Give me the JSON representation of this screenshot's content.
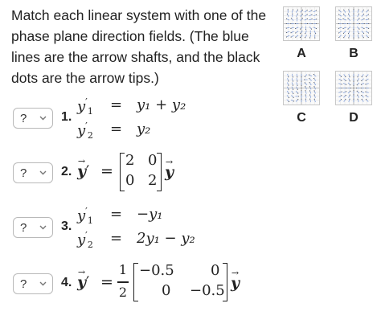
{
  "prompt": "Match each linear system with one of the phase plane direction fields. (The blue lines are the arrow shafts, and the black dots are the arrow tips.)",
  "options": [
    "A",
    "B",
    "C",
    "D"
  ],
  "dropdown_value": "?",
  "questions": [
    {
      "number": "1.",
      "row1": {
        "lhs": "y",
        "sub": "1",
        "prime": "′",
        "eq": "=",
        "rhs": "y₁ + y₂"
      },
      "row2": {
        "lhs": "y",
        "sub": "2",
        "prime": "′",
        "eq": "=",
        "rhs": "y₂"
      }
    },
    {
      "number": "2.",
      "vec": "y",
      "prime": "′",
      "eq": "=",
      "matrix": [
        "2",
        "0",
        "0",
        "2"
      ]
    },
    {
      "number": "3.",
      "row1": {
        "lhs": "y",
        "sub": "1",
        "prime": "′",
        "eq": "=",
        "rhs": "−y₁"
      },
      "row2": {
        "lhs": "y",
        "sub": "2",
        "prime": "′",
        "eq": "=",
        "rhs": "2y₁ − y₂"
      }
    },
    {
      "number": "4.",
      "vec": "y",
      "prime": "′",
      "eq": "=",
      "frac_num": "1",
      "frac_den": "2",
      "matrix": [
        "−0.5",
        "0",
        "0",
        "−0.5"
      ]
    }
  ]
}
